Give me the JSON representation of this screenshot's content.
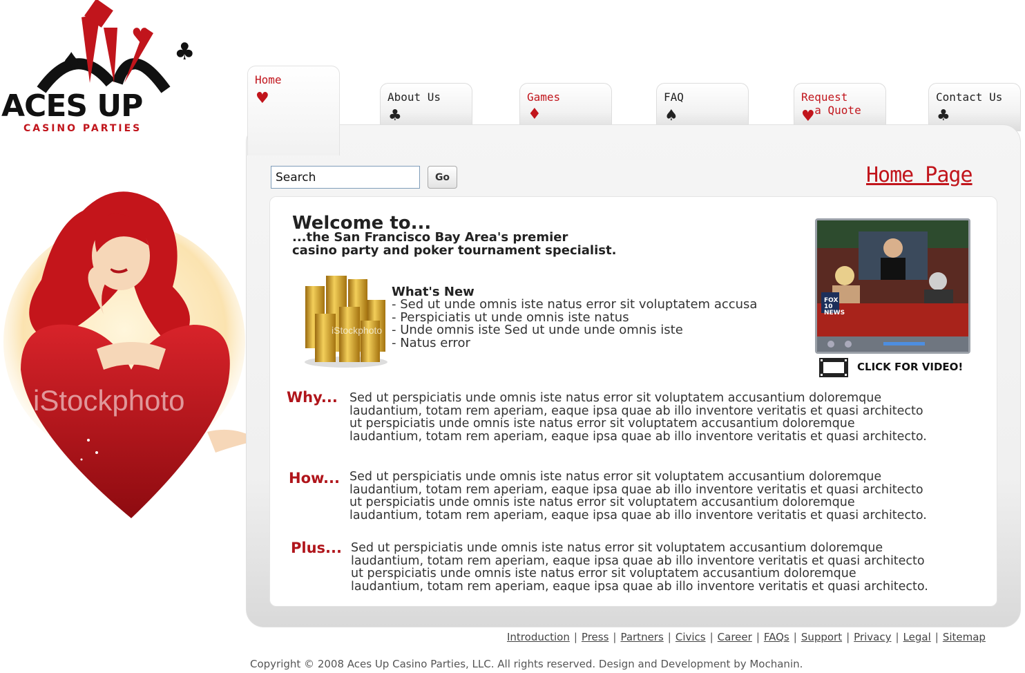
{
  "logo": {
    "title": "ACES UP",
    "subtitle": "CASINO PARTIES"
  },
  "hero": {
    "watermark": "iStockphoto"
  },
  "nav": {
    "tabs": [
      {
        "label": "Home",
        "suit": "♥",
        "suit_color": "#c1151c",
        "label_color": "#c1151c",
        "active": true
      },
      {
        "label": "About Us",
        "suit": "♣",
        "suit_color": "#222222",
        "label_color": "#222222",
        "active": false
      },
      {
        "label": "Games",
        "suit": "♦",
        "suit_color": "#c1151c",
        "label_color": "#c1151c",
        "active": false
      },
      {
        "label": "FAQ",
        "suit": "♠",
        "suit_color": "#222222",
        "label_color": "#222222",
        "active": false
      },
      {
        "label": "Request\n  a Quote",
        "suit": "♥",
        "suit_color": "#c1151c",
        "label_color": "#c1151c",
        "active": false
      },
      {
        "label": "Contact Us",
        "suit": "♣",
        "suit_color": "#222222",
        "label_color": "#222222",
        "active": false
      }
    ]
  },
  "search": {
    "value": "Search",
    "button_label": "Go"
  },
  "page_heading": "Home Page",
  "welcome": {
    "title": "Welcome to...",
    "subtitle": "...the San Francisco Bay Area's premier\ncasino party and poker tournament specialist."
  },
  "coins_watermark": "iStockphoto",
  "whats_new": {
    "title": "What's New",
    "items": [
      "- Sed ut unde omnis iste natus error sit voluptatem accusa",
      "- Perspiciatis ut unde omnis iste natus",
      "- Unde omnis iste Sed ut unde unde omnis iste",
      "- Natus error"
    ]
  },
  "video": {
    "caption": "CLICK FOR VIDEO!",
    "channel_badge": "FOX 10 NEWS"
  },
  "sections": [
    {
      "heading": "Why...",
      "lines": [
        "Sed ut perspiciatis unde omnis iste natus error sit voluptatem accusantium doloremque",
        "laudantium, totam rem aperiam, eaque ipsa quae ab illo inventore veritatis et quasi architecto",
        "ut perspiciatis unde omnis iste natus error sit voluptatem accusantium doloremque",
        "laudantium, totam rem aperiam, eaque ipsa quae ab illo inventore veritatis et quasi architecto."
      ]
    },
    {
      "heading": "How...",
      "lines": [
        "Sed ut perspiciatis unde omnis iste natus error sit voluptatem accusantium doloremque",
        "laudantium, totam rem aperiam, eaque ipsa quae ab illo inventore veritatis et quasi architecto",
        "ut perspiciatis unde omnis iste natus error sit voluptatem accusantium doloremque",
        "laudantium, totam rem aperiam, eaque ipsa quae ab illo inventore veritatis et quasi architecto."
      ]
    },
    {
      "heading": "Plus...",
      "lines": [
        "Sed ut perspiciatis unde omnis iste natus error sit voluptatem accusantium doloremque",
        "laudantium, totam rem aperiam, eaque ipsa quae ab illo inventore veritatis et quasi architecto",
        "ut perspiciatis unde omnis iste natus error sit voluptatem accusantium doloremque",
        "laudantium, totam rem aperiam, eaque ipsa quae ab illo inventore veritatis et quasi architecto."
      ]
    }
  ],
  "footer": {
    "links": [
      "Introduction",
      "Press",
      "Partners",
      "Civics",
      "Career",
      "FAQs",
      "Support",
      "Privacy",
      "Legal",
      "Sitemap"
    ],
    "copyright": "Copyright © 2008 Aces Up Casino Parties, LLC.  All rights reserved. Design and Development by Mochanin."
  },
  "colors": {
    "accent": "#c1151c",
    "heading_red": "#b0151b",
    "text": "#333333"
  }
}
